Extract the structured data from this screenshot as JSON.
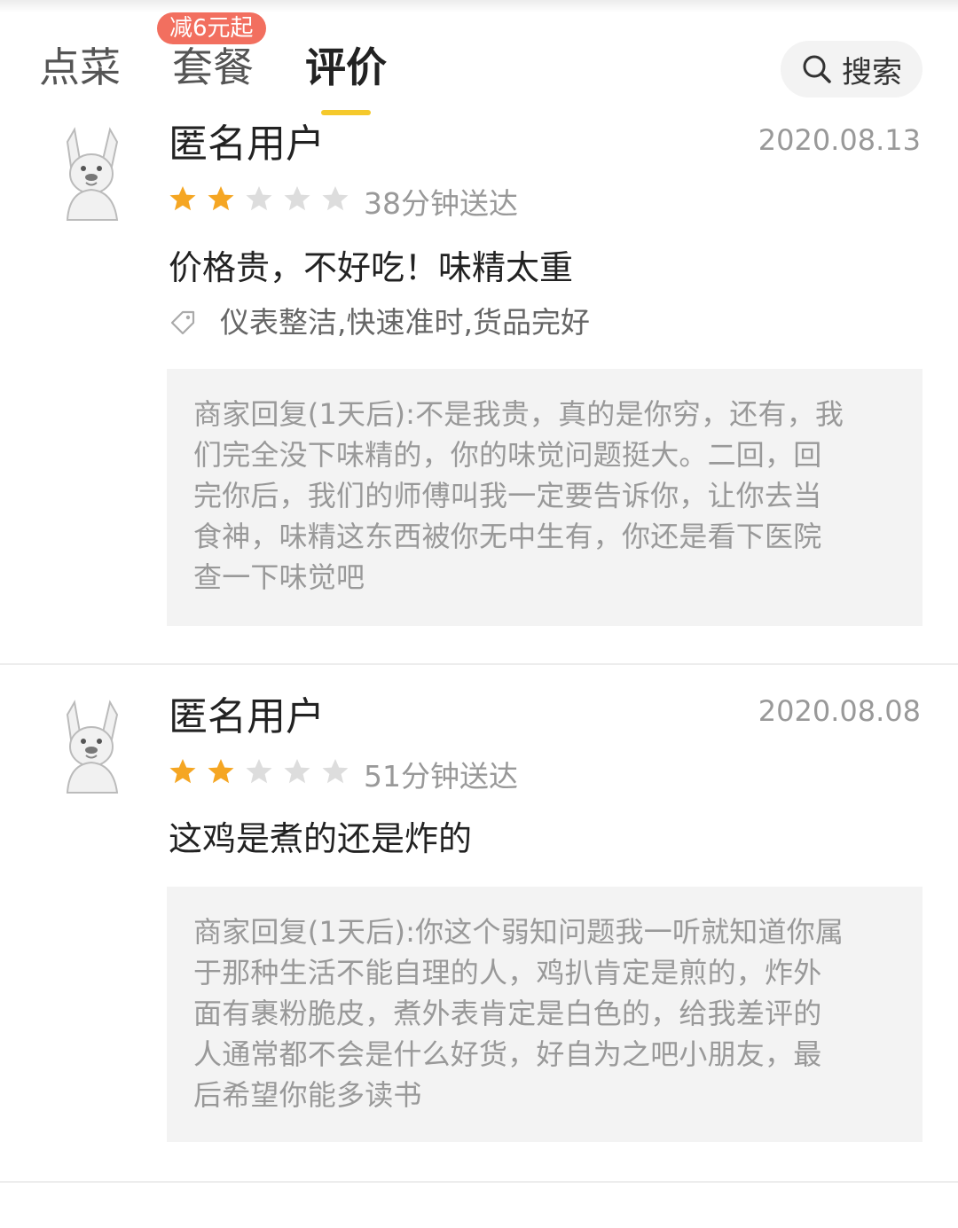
{
  "tabs": [
    {
      "label": "点菜",
      "active": false
    },
    {
      "label": "套餐",
      "active": false,
      "badge": "减6元起"
    },
    {
      "label": "评价",
      "active": true
    }
  ],
  "search": {
    "label": "搜索",
    "icon": "search-icon"
  },
  "colors": {
    "accent": "#f5c92c",
    "star_on": "#f5a623",
    "star_off": "#dddddd",
    "badge": "#f26f5f"
  },
  "reviews": [
    {
      "username": "匿名用户",
      "date": "2020.08.13",
      "rating": 2,
      "max_rating": 5,
      "delivery": "38分钟送达",
      "content": "价格贵，不好吃！味精太重",
      "tags": "仪表整洁,快速准时,货品完好",
      "reply_lines": [
        "商家回复(1天后):不是我贵，真的是你穷，还有，我",
        "们完全没下味精的，你的味觉问题挺大。二回，回",
        "完你后，我们的师傅叫我一定要告诉你，让你去当",
        "食神，味精这东西被你无中生有，你还是看下医院",
        "查一下味觉吧"
      ]
    },
    {
      "username": "匿名用户",
      "date": "2020.08.08",
      "rating": 2,
      "max_rating": 5,
      "delivery": "51分钟送达",
      "content": "这鸡是煮的还是炸的",
      "reply_lines": [
        "商家回复(1天后):你这个弱知问题我一听就知道你属",
        "于那种生活不能自理的人，鸡扒肯定是煎的，炸外",
        "面有裹粉脆皮，煮外表肯定是白色的，给我差评的",
        "人通常都不会是什么好货，好自为之吧小朋友，最",
        "后希望你能多读书"
      ]
    }
  ]
}
